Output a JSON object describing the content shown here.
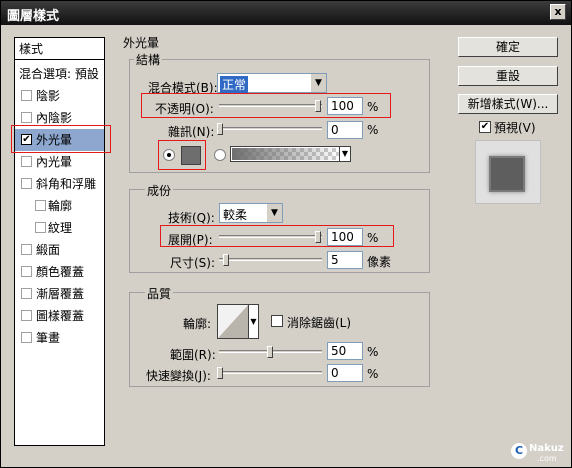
{
  "window": {
    "title": "圖層樣式",
    "close_symbol": "x"
  },
  "sidebar": {
    "header": "樣式",
    "blend_options": "混合選項: 預設",
    "items": [
      {
        "label": "陰影",
        "checked": false
      },
      {
        "label": "內陰影",
        "checked": false
      },
      {
        "label": "外光暈",
        "checked": true
      },
      {
        "label": "內光暈",
        "checked": false
      },
      {
        "label": "斜角和浮雕",
        "checked": false
      },
      {
        "label": "輪廓",
        "checked": false
      },
      {
        "label": "紋理",
        "checked": false
      },
      {
        "label": "緞面",
        "checked": false
      },
      {
        "label": "顏色覆蓋",
        "checked": false
      },
      {
        "label": "漸層覆蓋",
        "checked": false
      },
      {
        "label": "圖樣覆蓋",
        "checked": false
      },
      {
        "label": "筆畫",
        "checked": false
      }
    ],
    "check_mark": "✔"
  },
  "outer_glow": {
    "title": "外光暈",
    "structure": {
      "title": "結構",
      "blend_mode_label": "混合模式(B):",
      "blend_mode_value": "正常",
      "opacity_label": "不透明(O):",
      "opacity_value": "100",
      "noise_label": "雜訊(N):",
      "noise_value": "0",
      "percent": "%",
      "glow_color": "#6e6e6e"
    },
    "elements": {
      "title": "成份",
      "technique_label": "技術(Q):",
      "technique_value": "較柔",
      "spread_label": "展開(P):",
      "spread_value": "100",
      "size_label": "尺寸(S):",
      "size_value": "5",
      "size_unit": "像素",
      "percent": "%"
    },
    "quality": {
      "title": "品質",
      "contour_label": "輪廓:",
      "anti_alias_label": "消除鋸齒(L)",
      "range_label": "範圍(R):",
      "range_value": "50",
      "jitter_label": "快速變換(J):",
      "jitter_value": "0",
      "percent": "%"
    }
  },
  "buttons": {
    "ok": "確定",
    "reset": "重設",
    "new_style": "新增樣式(W)...",
    "preview_label": "預視(V)"
  },
  "watermark": "Nakuz",
  "watermark_sub": ".com",
  "colors": {
    "selected_row": "#8ea7cf",
    "highlight_red": "#e21a1a",
    "preview_swatch": "#5e5e5e"
  }
}
